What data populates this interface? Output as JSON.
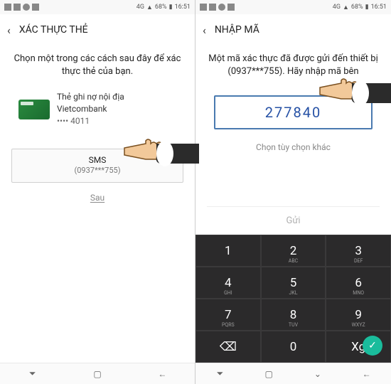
{
  "status": {
    "signal": "4G",
    "battery": "68%",
    "time": "16:51"
  },
  "left": {
    "title": "XÁC THỰC THẺ",
    "instructions": "Chọn một trong các cách sau đây để xác thực thẻ của bạn.",
    "card": {
      "name": "Thẻ ghi nợ nội địa",
      "bank": "Vietcombank",
      "masked": "•••• 4011"
    },
    "sms": {
      "label": "SMS",
      "number": "(0937***755)"
    },
    "skip": "Sau"
  },
  "right": {
    "title": "NHẬP MÃ",
    "instructions": "Một mã xác thực đã được gửi đến thiết bị (0937***755). Hãy nhập mã bên",
    "code": "277840",
    "other": "Chọn tùy chọn khác",
    "send": "Gửi",
    "keys": [
      [
        "1",
        "2",
        "3"
      ],
      [
        "4",
        "5",
        "6"
      ],
      [
        "7",
        "8",
        "9"
      ],
      [
        "⌫",
        "0",
        "Xg"
      ]
    ],
    "subs": {
      "2": "ABC",
      "3": "DEF",
      "4": "GHI",
      "5": "JKL",
      "6": "MNO",
      "7": "PQRS",
      "8": "TUV",
      "9": "WXYZ"
    }
  }
}
